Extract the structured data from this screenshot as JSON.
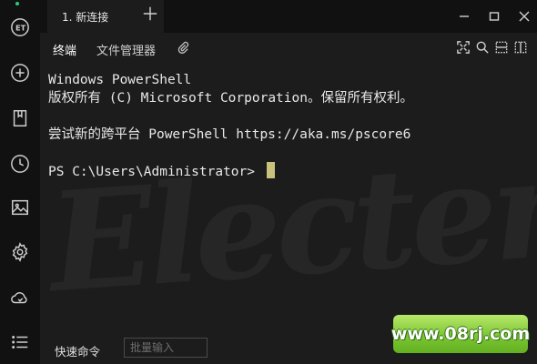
{
  "app": {
    "logo_text": "ET"
  },
  "tabs": [
    {
      "label": "1. 新连接"
    }
  ],
  "subtabs": [
    {
      "label": "终端"
    },
    {
      "label": "文件管理器"
    }
  ],
  "terminal": {
    "lines": [
      "Windows PowerShell",
      "版权所有 (C) Microsoft Corporation。保留所有权利。",
      "",
      "尝试新的跨平台 PowerShell https://aka.ms/pscore6",
      ""
    ],
    "prompt": "PS C:\\Users\\Administrator> "
  },
  "bottom": {
    "quick_command_label": "快速命令",
    "batch_input_placeholder": "批量输入"
  },
  "watermark": "www.08rj.com",
  "colors": {
    "accent": "#2ecc71",
    "cursor": "#c9c27a",
    "background": "#1c1c1c",
    "rail": "#111111"
  }
}
